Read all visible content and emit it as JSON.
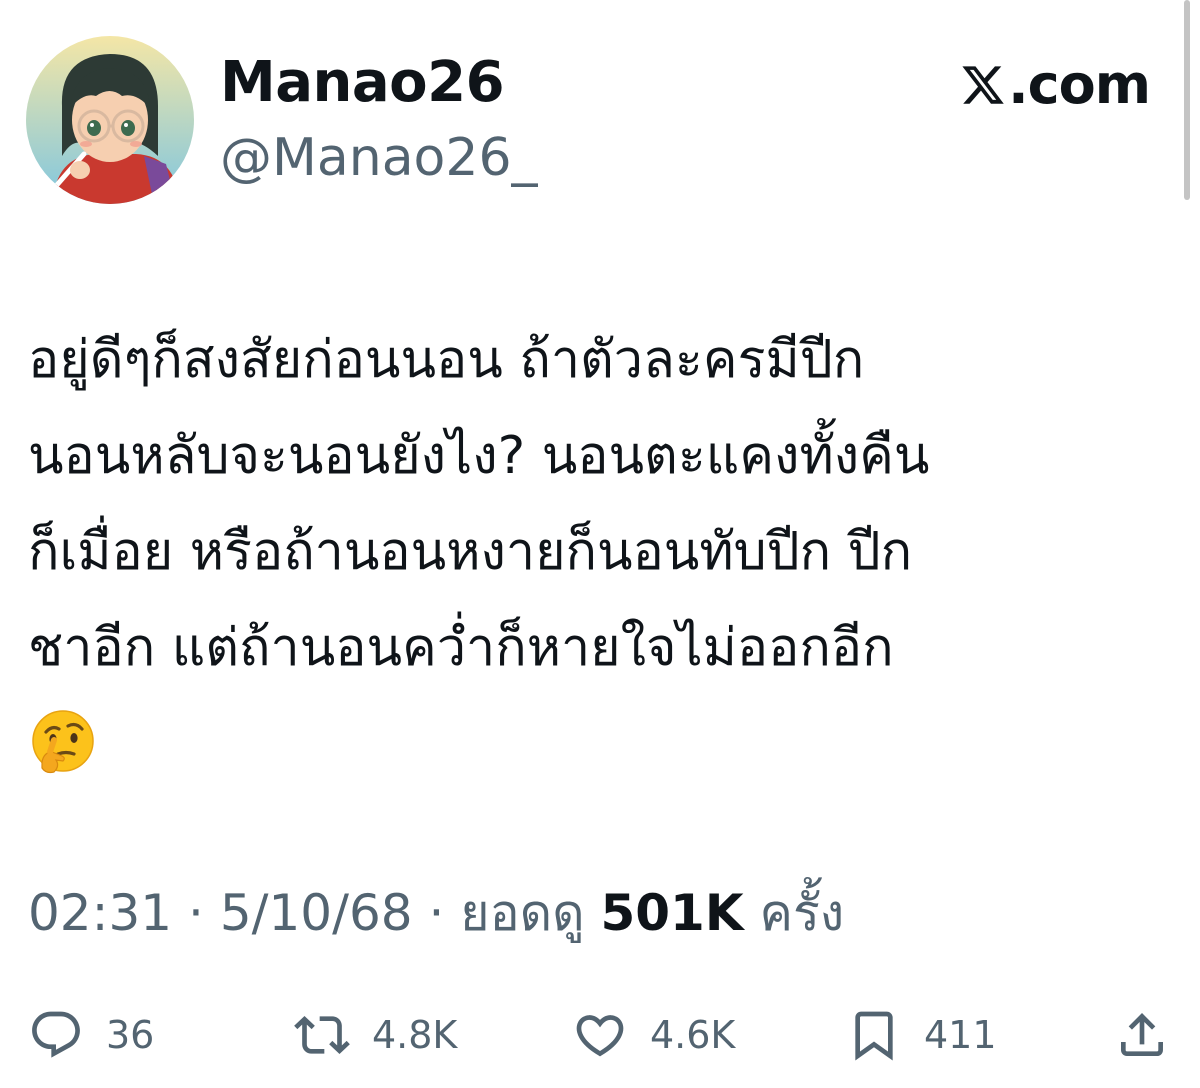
{
  "user": {
    "display_name": "Manao26",
    "handle": "@Manao26_"
  },
  "brand": {
    "text": ".com",
    "icon": "x-logo-icon"
  },
  "tweet": {
    "lines": [
      "อยู่ดีๆก็สงสัยก่อนนอน ถ้าตัวละครมีปีก",
      "นอนหลับจะนอนยังไง? นอนตะแคงทั้งคืน",
      "ก็เมื่อย หรือถ้านอนหงายก็นอนทับปีก ปีก",
      "ชาอีก แต่ถ้านอนคว่ำก็หายใจไม่ออกอีก"
    ],
    "emoji": "🤔"
  },
  "meta": {
    "time": "02:31",
    "separator": "·",
    "date": "5/10/68",
    "views_prefix": "ยอดดู",
    "views_count": "501K",
    "views_suffix": "ครั้ง"
  },
  "actions": {
    "reply": {
      "icon": "reply-icon",
      "count": "36"
    },
    "repost": {
      "icon": "repost-icon",
      "count": "4.8K"
    },
    "like": {
      "icon": "heart-icon",
      "count": "4.6K"
    },
    "bookmark": {
      "icon": "bookmark-icon",
      "count": "411"
    },
    "share": {
      "icon": "share-icon"
    }
  },
  "colors": {
    "text_primary": "#0f1419",
    "text_secondary": "#536471",
    "background": "#ffffff"
  }
}
